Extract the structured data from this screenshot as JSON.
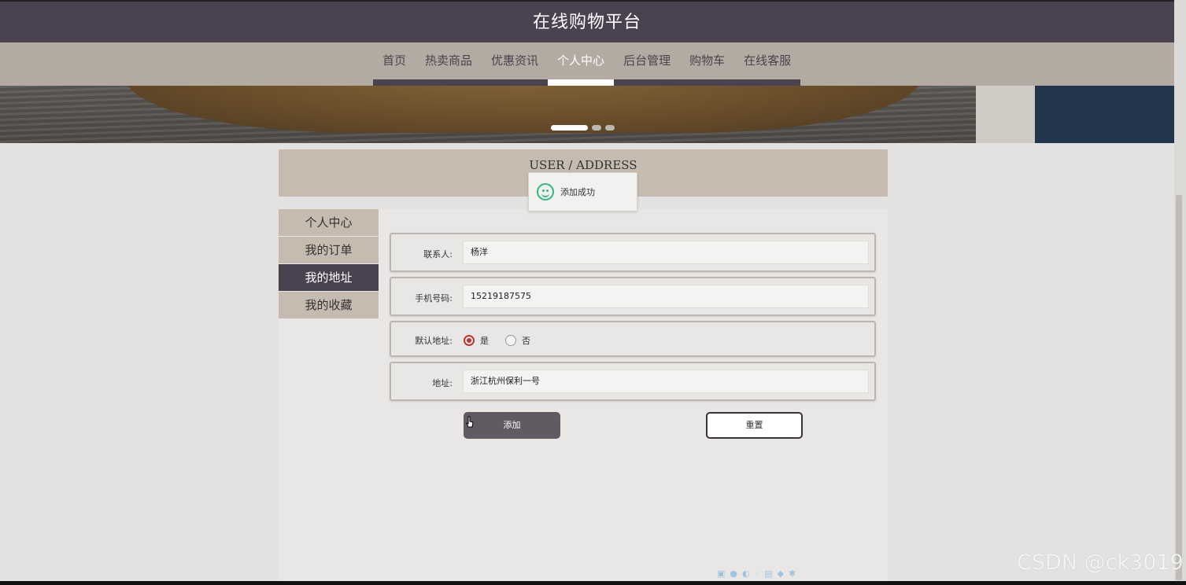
{
  "header": {
    "title": "在线购物平台"
  },
  "nav": {
    "items": [
      {
        "label": "首页",
        "active": false
      },
      {
        "label": "热卖商品",
        "active": false
      },
      {
        "label": "优惠资讯",
        "active": false
      },
      {
        "label": "个人中心",
        "active": true
      },
      {
        "label": "后台管理",
        "active": false
      },
      {
        "label": "购物车",
        "active": false
      },
      {
        "label": "在线客服",
        "active": false
      }
    ]
  },
  "banner": {
    "slide_count": 3,
    "active_slide": 1
  },
  "section": {
    "heading": "USER / ADDRESS"
  },
  "toast": {
    "message": "添加成功",
    "icon": "smile-icon"
  },
  "sidebar": {
    "items": [
      {
        "label": "个人中心",
        "active": false
      },
      {
        "label": "我的订单",
        "active": false
      },
      {
        "label": "我的地址",
        "active": true
      },
      {
        "label": "我的收藏",
        "active": false
      }
    ]
  },
  "form": {
    "contact": {
      "label": "联系人:",
      "value": "杨洋"
    },
    "phone": {
      "label": "手机号码:",
      "value": "15219187575"
    },
    "default_address": {
      "label": "默认地址:",
      "options": [
        {
          "label": "是",
          "checked": true
        },
        {
          "label": "否",
          "checked": false
        }
      ]
    },
    "address": {
      "label": "地址:",
      "value": "浙江杭州保利一号"
    },
    "add_button": "添加",
    "reset_button": "重置"
  },
  "watermark": "CSDN @ck3019",
  "colors": {
    "header_bg": "#4a4250",
    "nav_bg": "#b3aaa1",
    "accent_tan": "#c5bbaf",
    "radio_red": "#c9302c",
    "toast_green": "#2fb786"
  }
}
